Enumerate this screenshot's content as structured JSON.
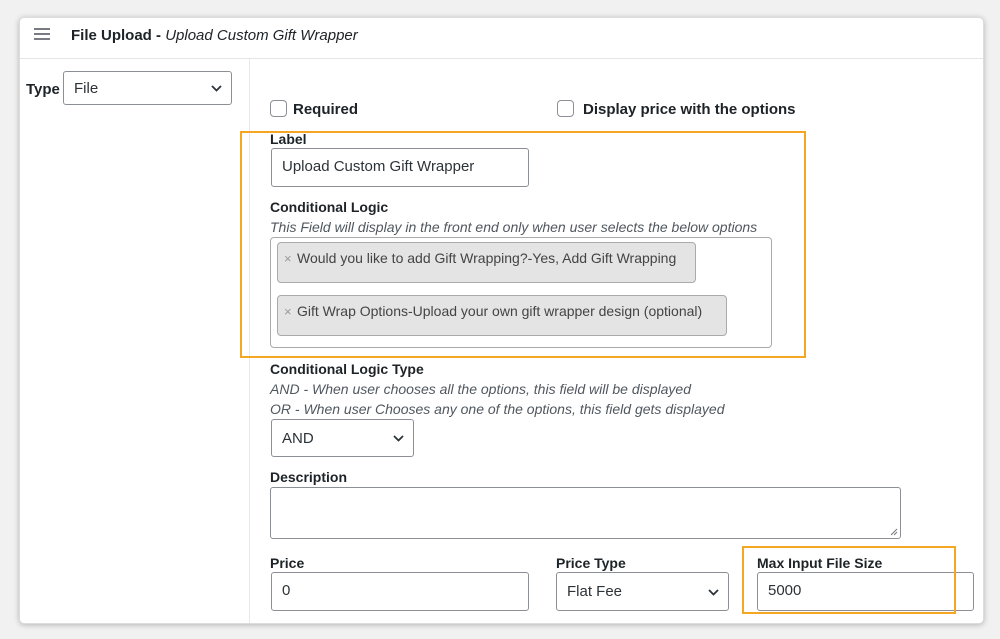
{
  "header": {
    "title": "File Upload",
    "separator": " - ",
    "subtitle": "Upload Custom Gift Wrapper"
  },
  "type_field": {
    "label": "Type",
    "value": "File"
  },
  "options": {
    "required_label": "Required",
    "display_price_label": "Display price with the options"
  },
  "label_field": {
    "label": "Label",
    "value": "Upload Custom Gift Wrapper"
  },
  "conditional_logic": {
    "label": "Conditional Logic",
    "help": "This Field will display in the front end only when user selects the below options",
    "tags": [
      "Would you like to add Gift Wrapping?-Yes, Add Gift Wrapping",
      "Gift Wrap Options-Upload your own gift wrapper design (optional)"
    ],
    "remove_glyph": "×"
  },
  "conditional_logic_type": {
    "label": "Conditional Logic Type",
    "help_and": "AND - When user chooses all the options, this field will be displayed",
    "help_or": "OR - When user Chooses any one of the options, this field gets displayed",
    "value": "AND"
  },
  "description": {
    "label": "Description",
    "value": ""
  },
  "price": {
    "label": "Price",
    "value": "0"
  },
  "price_type": {
    "label": "Price Type",
    "value": "Flat Fee"
  },
  "max_file_size": {
    "label": "Max Input File Size",
    "value": "5000"
  },
  "colors": {
    "highlight": "#f5a623",
    "tag_bg": "#e4e4e4"
  },
  "icons": {
    "menu": "hamburger-icon",
    "dropdown": "chevron-down-icon",
    "remove": "close-icon",
    "resize": "resize-handle-icon"
  }
}
